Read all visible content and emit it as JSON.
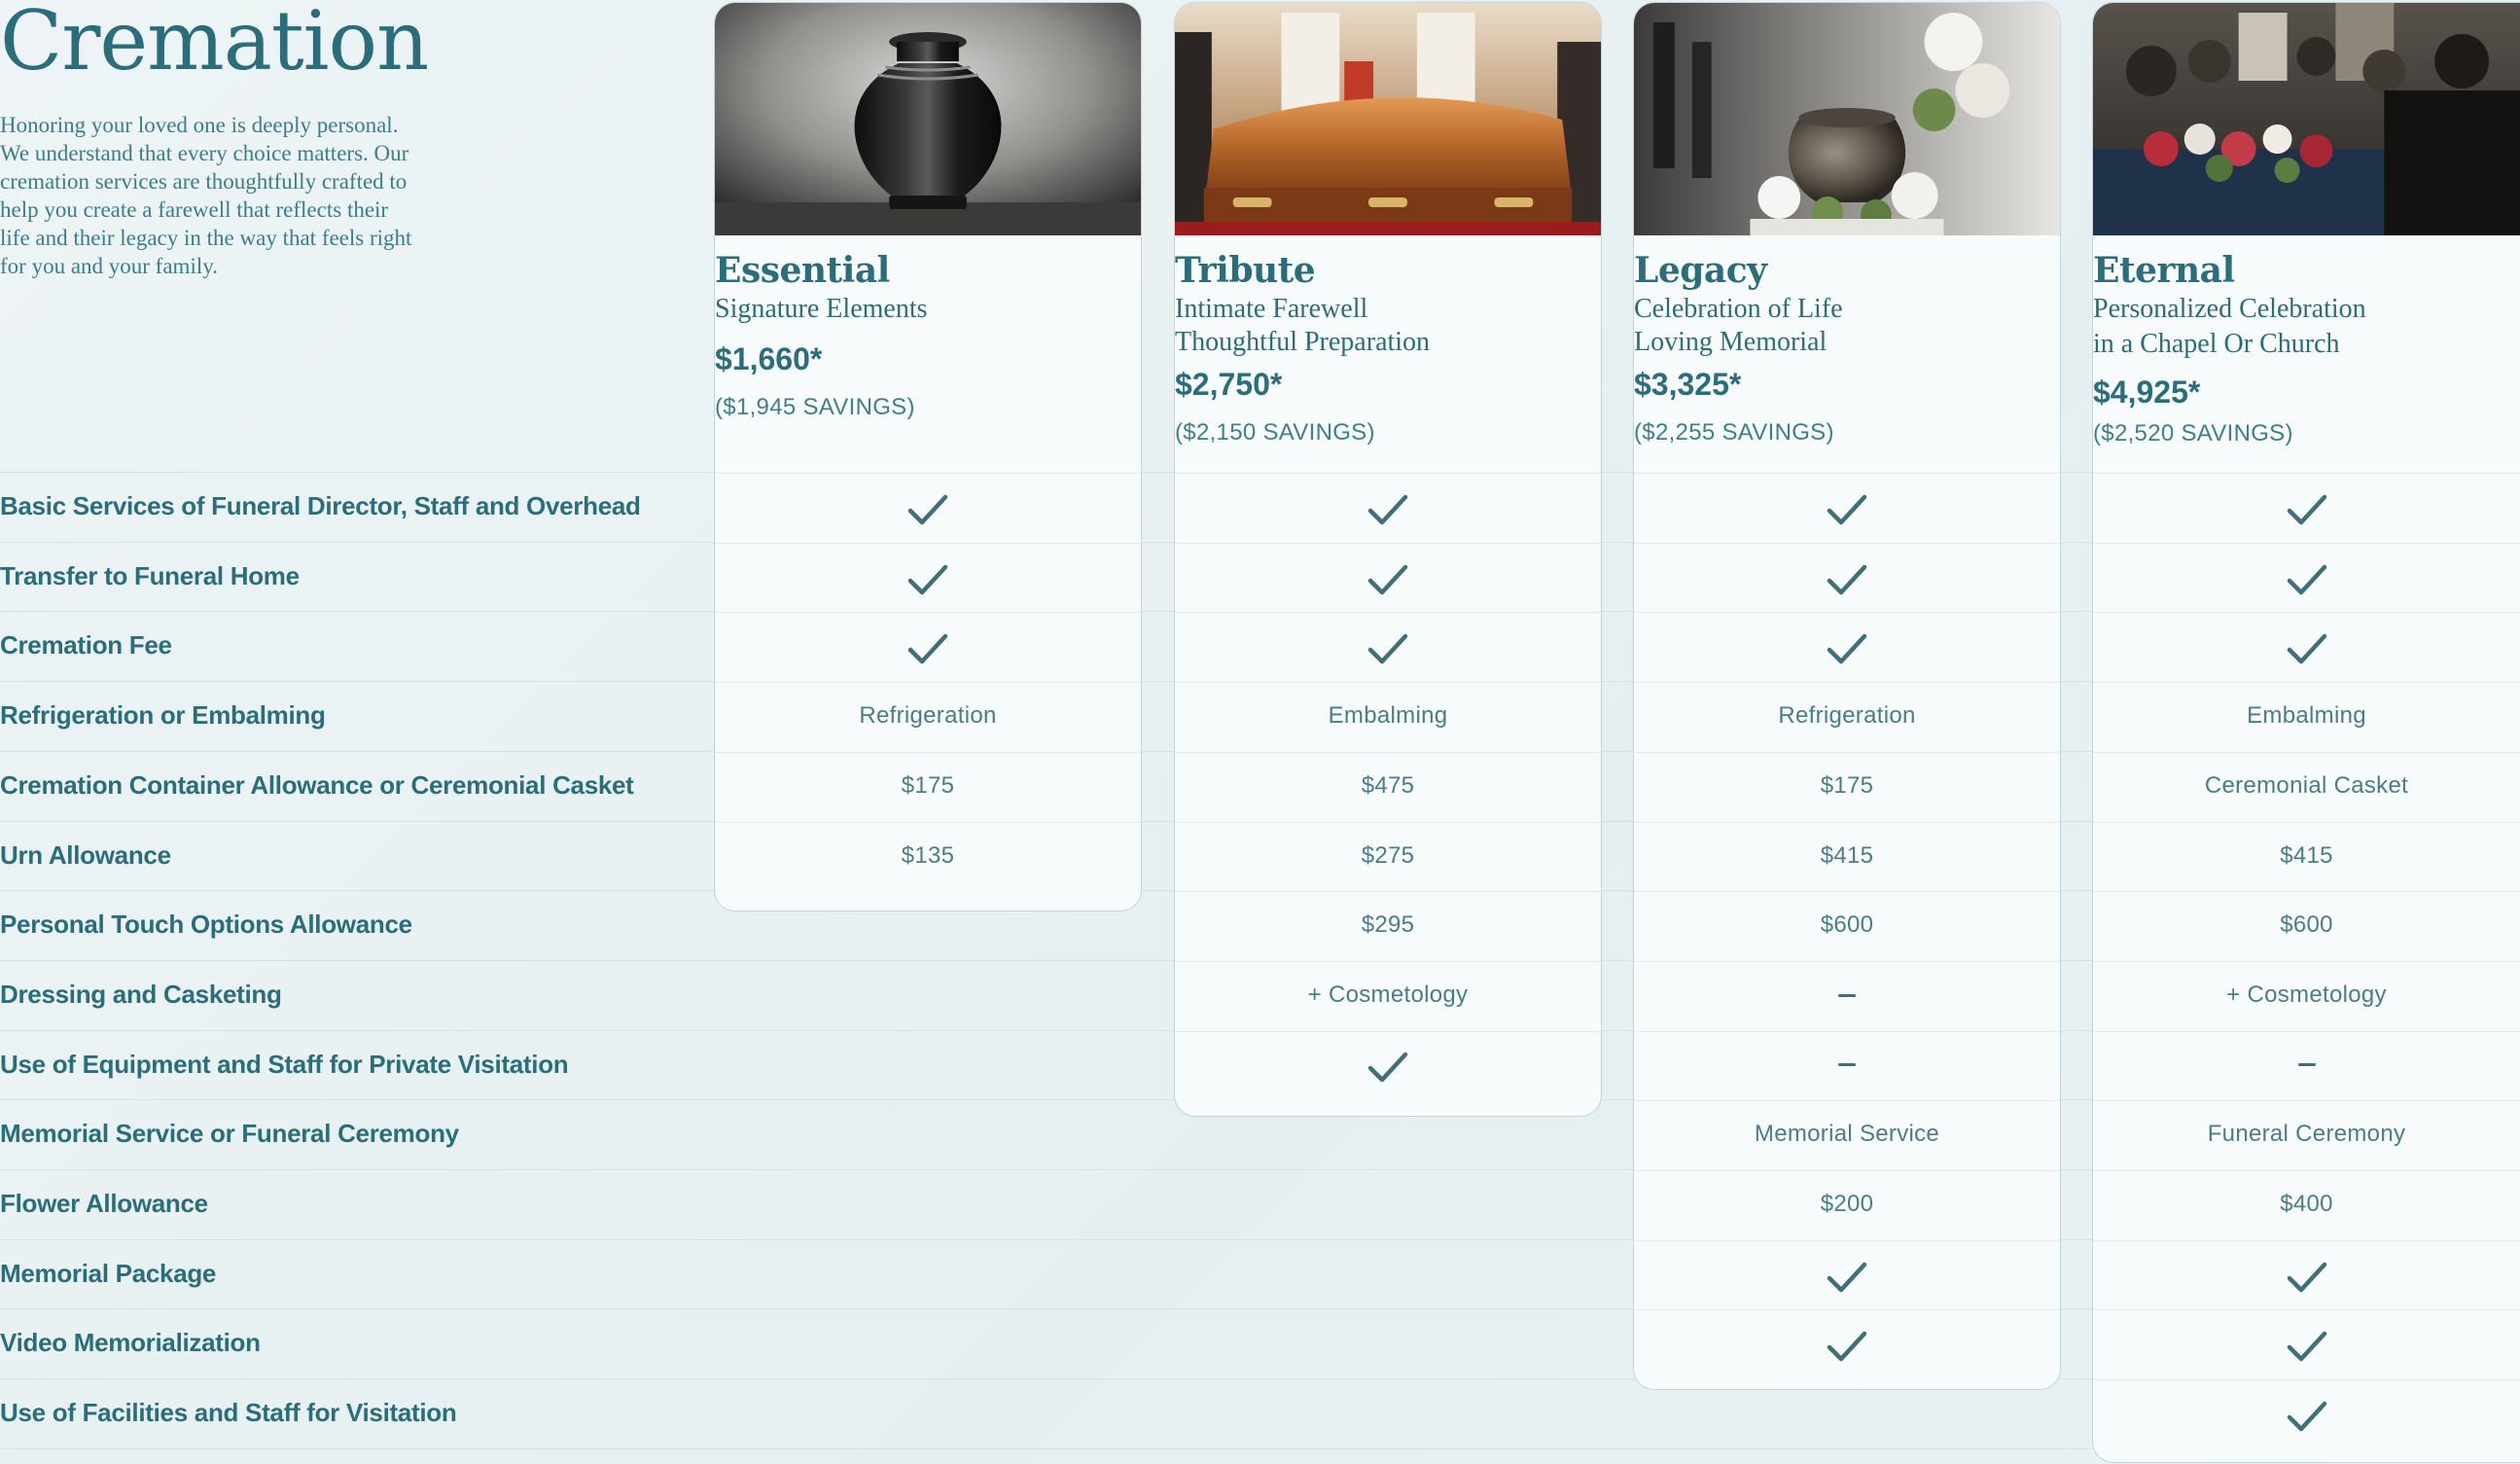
{
  "page": {
    "title": "Cremation",
    "intro": "Honoring your loved one is deeply personal. We understand that every choice matters. Our cremation services are thoughtfully crafted to help you create a farewell that reflects their life and their legacy in the way that feels right for you and your family."
  },
  "rows": [
    "Basic Services of Funeral Director, Staff and Overhead",
    "Transfer to Funeral Home",
    "Cremation Fee",
    "Refrigeration or Embalming",
    "Cremation Container Allowance or Ceremonial Casket",
    "Urn Allowance",
    "Personal Touch Options Allowance",
    "Dressing and Casketing",
    "Use of Equipment and Staff for Private Visitation",
    "Memorial Service or Funeral Ceremony",
    "Flower Allowance",
    "Memorial Package",
    "Video Memorialization",
    "Use of Facilities and Staff for Visitation"
  ],
  "icons": {
    "included": "check-icon",
    "not_included": "dash-icon"
  },
  "colors": {
    "accent": "#2a6e7b",
    "check": "#3f6f77",
    "card_border": "#c1d6da"
  },
  "packages": [
    {
      "id": "essential",
      "name": "Essential",
      "subtitle": [
        "Signature Elements"
      ],
      "price": "$1,660*",
      "savings": "($1,945 SAVINGS)",
      "photo": "black-urn-photo",
      "cells": [
        "check",
        "check",
        "check",
        "Refrigeration",
        "$175",
        "$135"
      ]
    },
    {
      "id": "tribute",
      "name": "Tribute",
      "subtitle": [
        "Intimate Farewell",
        "Thoughtful Preparation"
      ],
      "price": "$2,750*",
      "savings": "($2,150 SAVINGS)",
      "photo": "wooden-casket-photo",
      "cells": [
        "check",
        "check",
        "check",
        "Embalming",
        "$475",
        "$275",
        "$295",
        "+ Cosmetology",
        "check"
      ]
    },
    {
      "id": "legacy",
      "name": "Legacy",
      "subtitle": [
        "Celebration of Life",
        "Loving Memorial"
      ],
      "price": "$3,325*",
      "savings": "($2,255 SAVINGS)",
      "photo": "urn-with-flowers-photo",
      "cells": [
        "check",
        "check",
        "check",
        "Refrigeration",
        "$175",
        "$415",
        "$600",
        "dash",
        "dash",
        "Memorial Service",
        "$200",
        "check",
        "check"
      ]
    },
    {
      "id": "eternal",
      "name": "Eternal",
      "subtitle": [
        "Personalized Celebration",
        "in a Chapel Or Church"
      ],
      "price": "$4,925*",
      "savings": "($2,520 SAVINGS)",
      "photo": "chapel-ceremony-photo",
      "cells": [
        "check",
        "check",
        "check",
        "Embalming",
        "Ceremonial Casket",
        "$415",
        "$600",
        "+ Cosmetology",
        "dash",
        "Funeral Ceremony",
        "$400",
        "check",
        "check",
        "check"
      ]
    }
  ]
}
